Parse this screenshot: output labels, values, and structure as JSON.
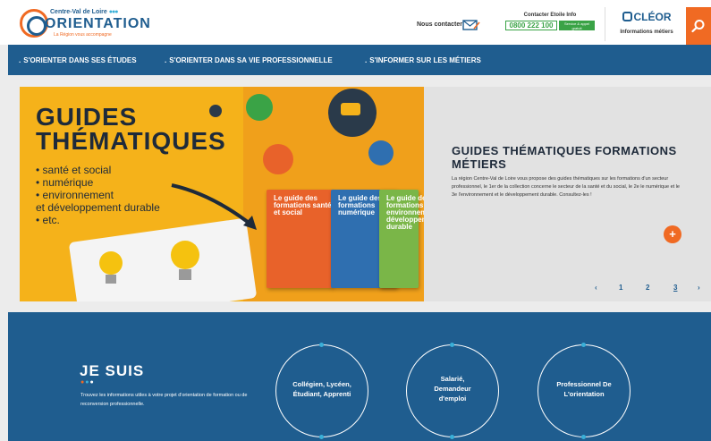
{
  "header": {
    "logo": {
      "region": "Centre-Val de Loire",
      "name": "ORIENTATION",
      "tagline": "La Région vous accompagne"
    },
    "contact_label": "Nous contacter",
    "etoile": {
      "title": "Contacter Etoile Info",
      "phone": "0800 222 100",
      "free_note": "Service & appel gratuit"
    },
    "cleor": {
      "brand": "CLÉOR",
      "subtitle": "Informations métiers"
    }
  },
  "nav": {
    "items": [
      "S'ORIENTER DANS SES ÉTUDES",
      "S'ORIENTER DANS SA VIE PROFESSIONNELLE",
      "S'INFORMER SUR LES MÉTIERS"
    ]
  },
  "banner": {
    "title_line1": "GUIDES",
    "title_line2": "THÉMATIQUES",
    "list": [
      "• santé et social",
      "• numérique",
      "• environnement",
      "   et développement durable",
      "• etc."
    ],
    "books": [
      {
        "title": "Le guide des formations santé et social",
        "color": "#e8622a"
      },
      {
        "title": "Le guide des formations numérique",
        "color": "#2f6fb0"
      },
      {
        "title": "Le guide des formations environnement développement durable",
        "color": "#7ab648"
      }
    ]
  },
  "slide": {
    "title": "GUIDES THÉMATIQUES FORMATIONS MÉTIERS",
    "description": "La région Centre-Val de Loire vous propose des guides thématiques sur les formations d'un secteur professionnel, le 1er de la collection concerne le secteur de la santé et du social, le 2e le numérique et le 3e l'environnement et le développement durable. Consultez-les !",
    "plus": "+",
    "pager": {
      "prev": "‹",
      "pages": [
        "1",
        "2",
        "3"
      ],
      "active": "3",
      "next": "›"
    }
  },
  "je_suis": {
    "title": "JE SUIS",
    "description": "Trouvez les informations utiles à votre projet d'orientation de formation ou de reconversion professionnelle.",
    "profiles": [
      "Collégien, Lycéen, Étudiant, Apprenti",
      "Salarié, Demandeur d'emploi",
      "Professionnel De L'orientation"
    ]
  },
  "colors": {
    "primary": "#1f5d8f",
    "accent": "#f06a23",
    "light_blue": "#3ab0d8",
    "green": "#3aa346",
    "banner_yellow": "#f5b21a"
  }
}
